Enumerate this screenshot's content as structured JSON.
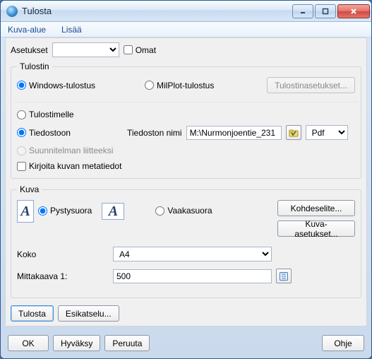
{
  "window": {
    "title": "Tulosta"
  },
  "menu": {
    "kuva_alue": "Kuva-alue",
    "lisaa": "Lisää"
  },
  "settings_row": {
    "label": "Asetukset",
    "omat": "Omat"
  },
  "printer_group": {
    "legend": "Tulostin",
    "windows": "Windows-tulostus",
    "milplot": "MilPlot-tulostus",
    "printer_settings_btn": "Tulostinasetukset...",
    "to_printer": "Tulostimelle",
    "to_file": "Tiedostoon",
    "file_label": "Tiedoston nimi",
    "file_value": "M:\\Nurmonjoentie_231",
    "format": "Pdf",
    "as_attachment": "Suunnitelman liitteeksi",
    "write_meta": "Kirjoita kuvan metatiedot"
  },
  "image_group": {
    "legend": "Kuva",
    "portrait": "Pystysuora",
    "landscape": "Vaakasuora",
    "kohdeselite_btn": "Kohdeselite...",
    "kuva_asetukset_btn": "Kuva-asetukset...",
    "size_label": "Koko",
    "size_value": "A4",
    "scale_label": "Mittakaava  1:",
    "scale_value": "500"
  },
  "actions": {
    "print": "Tulosta",
    "preview": "Esikatselu..."
  },
  "bottom": {
    "ok": "OK",
    "apply": "Hyväksy",
    "cancel": "Peruuta",
    "help": "Ohje"
  }
}
